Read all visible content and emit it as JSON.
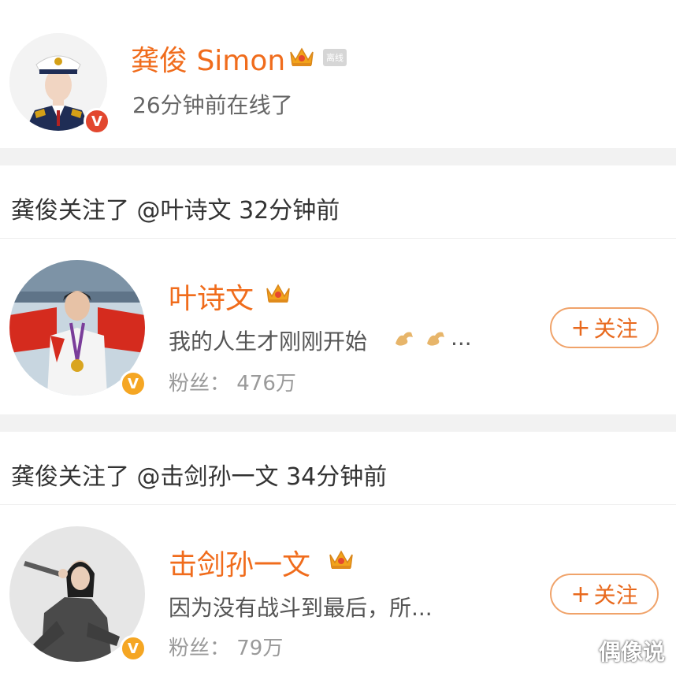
{
  "profile": {
    "name": "龚俊 Simon",
    "status_tag": "离线",
    "online_text": "26分钟前在线了"
  },
  "activities": [
    {
      "text": "龚俊关注了 @叶诗文 32分钟前",
      "user": {
        "name": "叶诗文",
        "bio": "我的人生才刚刚开始",
        "bio_ellipsis": "...",
        "fans": "粉丝： 476万",
        "follow_label": "关注"
      }
    },
    {
      "text": "龚俊关注了 @击剑孙一文 34分钟前",
      "user": {
        "name": "击剑孙一文",
        "bio": "因为没有战斗到最后，所...",
        "fans": "粉丝： 79万",
        "follow_label": "关注"
      }
    }
  ],
  "icons": {
    "verified": "V",
    "plus": "+",
    "crown": "crown-icon",
    "flex": "flexed-biceps-emoji"
  },
  "watermark": "偶像说",
  "colors": {
    "accent": "#f06c1c",
    "badge_gold": "#f5a623",
    "badge_red": "#e2472f",
    "divider": "#f2f2f2"
  }
}
